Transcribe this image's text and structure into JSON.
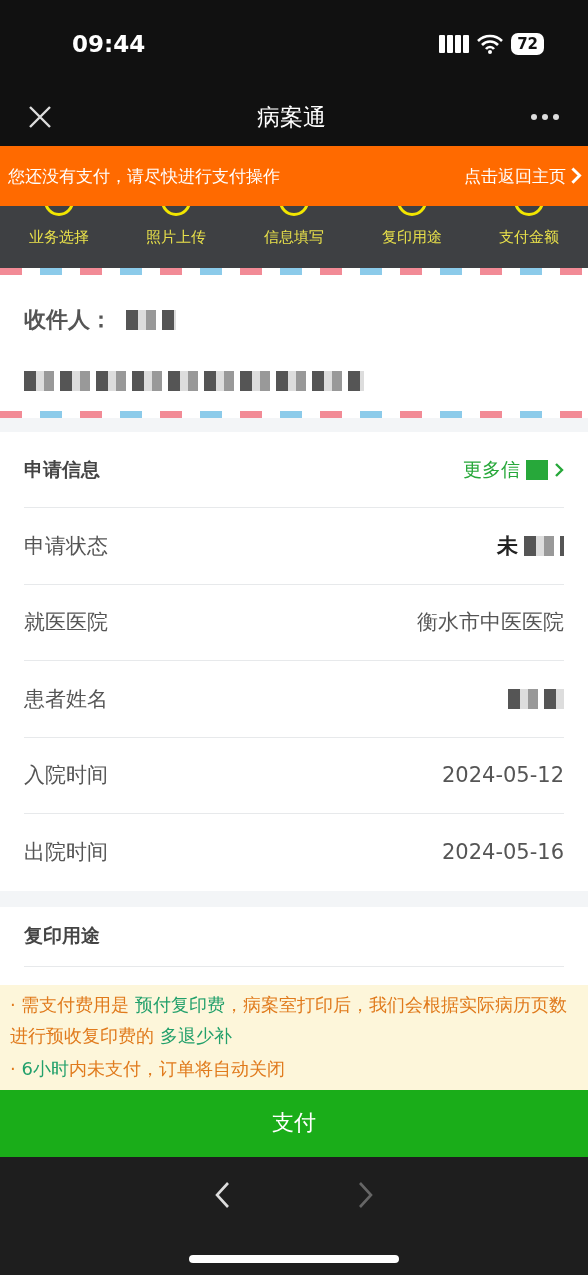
{
  "status_bar": {
    "time": "09:44",
    "battery": "72"
  },
  "nav": {
    "title": "病案通"
  },
  "banner": {
    "message": "您还没有支付，请尽快进行支付操作",
    "link": "点击返回主页"
  },
  "steps": [
    {
      "label": "业务选择"
    },
    {
      "label": "照片上传"
    },
    {
      "label": "信息填写"
    },
    {
      "label": "复印用途"
    },
    {
      "label": "支付金额"
    }
  ],
  "recipient": {
    "label": "收件人：",
    "redacted": true
  },
  "info": {
    "title": "申请信息",
    "more": "更多信",
    "more_redacted": true,
    "rows": [
      {
        "label": "申请状态",
        "value": "未",
        "redacted": true
      },
      {
        "label": "就医医院",
        "value": "衡水市中医医院"
      },
      {
        "label": "患者姓名",
        "redacted": true
      },
      {
        "label": "入院时间",
        "value": "2024-05-12"
      },
      {
        "label": "出院时间",
        "value": "2024-05-16"
      }
    ]
  },
  "purpose": {
    "title": "复印用途"
  },
  "notes": [
    {
      "bullet": "·",
      "segments": [
        {
          "text": "需支付费用是 ",
          "emphasis": false
        },
        {
          "text": "预付复印费",
          "emphasis": true
        },
        {
          "text": "，病案室打印后，我们会根据实际病历页数进行预收复印费的 ",
          "emphasis": false
        },
        {
          "text": "多退少补",
          "emphasis": true
        }
      ]
    },
    {
      "bullet": "·",
      "segments": [
        {
          "text": "6小时",
          "emphasis": true
        },
        {
          "text": "内未支付，订单将自动关闭",
          "emphasis": false
        }
      ]
    }
  ],
  "pay_button": "支付",
  "browser_nav": {
    "back_disabled": false,
    "forward_disabled": true
  }
}
